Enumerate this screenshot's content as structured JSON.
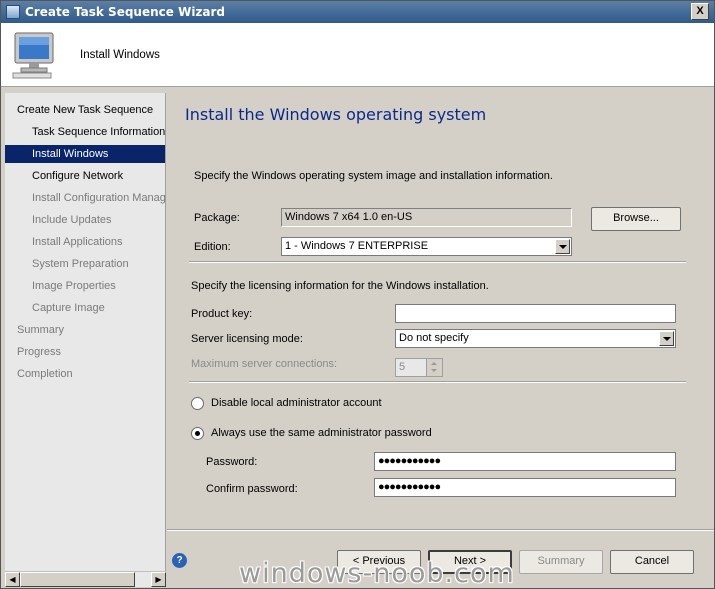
{
  "window": {
    "title": "Create Task Sequence Wizard",
    "close_label": "X"
  },
  "header": {
    "title": "Install Windows",
    "icon": "computer-monitor-icon"
  },
  "nav": {
    "items": [
      {
        "label": "Create New Task Sequence",
        "state": "normal"
      },
      {
        "label": "Task Sequence Information",
        "state": "normal"
      },
      {
        "label": "Install Windows",
        "state": "selected"
      },
      {
        "label": "Configure Network",
        "state": "normal"
      },
      {
        "label": "Install Configuration Manag",
        "state": "disabled"
      },
      {
        "label": "Include Updates",
        "state": "disabled"
      },
      {
        "label": "Install Applications",
        "state": "disabled"
      },
      {
        "label": "System Preparation",
        "state": "disabled"
      },
      {
        "label": "Image Properties",
        "state": "disabled"
      },
      {
        "label": "Capture Image",
        "state": "disabled"
      },
      {
        "label": "Summary",
        "state": "disabled"
      },
      {
        "label": "Progress",
        "state": "disabled"
      },
      {
        "label": "Completion",
        "state": "disabled"
      }
    ]
  },
  "main": {
    "page_title": "Install the Windows operating system",
    "intro": "Specify the Windows operating system image and installation information.",
    "package_label": "Package:",
    "package_value": "Windows 7 x64 1.0 en-US",
    "browse_label": "Browse...",
    "edition_label": "Edition:",
    "edition_value": "1 - Windows 7 ENTERPRISE",
    "licensing_intro": "Specify the licensing information for the Windows installation.",
    "product_key_label": "Product key:",
    "product_key_value": "",
    "server_mode_label": "Server licensing mode:",
    "server_mode_value": "Do not specify",
    "max_conn_label": "Maximum server connections:",
    "max_conn_value": "5",
    "radio_disable_label": "Disable local administrator account",
    "radio_always_label": "Always use the same administrator password",
    "password_label": "Password:",
    "password_value": "●●●●●●●●●●●",
    "confirm_label": "Confirm password:",
    "confirm_value": "●●●●●●●●●●●"
  },
  "footer": {
    "help_label": "?",
    "previous_label": "< Previous",
    "next_label": "Next >",
    "summary_label": "Summary",
    "cancel_label": "Cancel"
  },
  "watermark": "windows-noob.com",
  "colors": {
    "selected_bg": "#0a246a",
    "title_blue": "#0a2a8a"
  }
}
